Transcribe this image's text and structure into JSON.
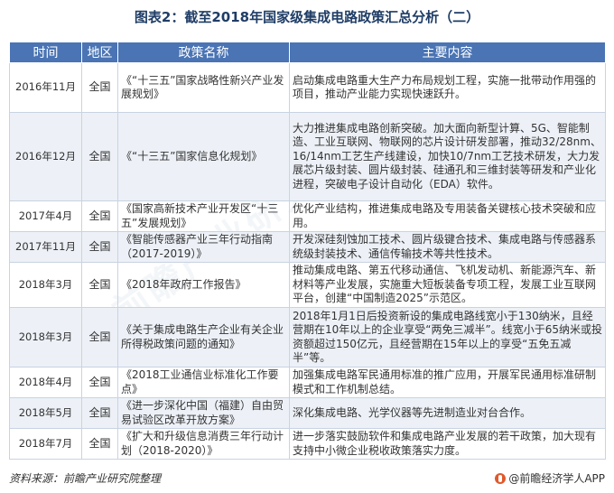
{
  "title": "图表2：截至2018年国家级集成电路政策汇总分析（二）",
  "table": {
    "headers": [
      "时间",
      "地区",
      "政策名称",
      "主要内容"
    ],
    "rows": [
      {
        "time": "2016年11月",
        "region": "全国",
        "name": "《“十三五”国家战略性新兴产业发展规划》",
        "content": "启动集成电路重大生产力布局规划工程，实施一批带动作用强的项目，推动产业能力实现快速跃升。"
      },
      {
        "time": "2016年12月",
        "region": "全国",
        "name": "《“十三五”国家信息化规划》",
        "content": "大力推进集成电路创新突破。加大面向新型计算、5G、智能制造、工业互联网、物联网的芯片设计研发部署，推动32/28nm、16/14nm工艺生产线建设，加快10/7nm工艺技术研发，大力发展芯片级封装、圆片级封装、硅通孔和三维封装等研发和产业化进程，突破电子设计自动化（EDA）软件。"
      },
      {
        "time": "2017年4月",
        "region": "全国",
        "name": "《国家高新技术产业开发区“十三五”发展规划》",
        "content": "优化产业结构，推进集成电路及专用装备关键核心技术突破和应用。"
      },
      {
        "time": "2017年11月",
        "region": "全国",
        "name": "《智能传感器产业三年行动指南（2017-2019）》",
        "content": "开发深硅刻蚀加工技术、圆片级键合技术、集成电路与传感器系统级封装技术、通信传输技术等共性技术。"
      },
      {
        "time": "2018年3月",
        "region": "全国",
        "name": "《2018年政府工作报告》",
        "content": "推动集成电路、第五代移动通信、飞机发动机、新能源汽车、新材料等产业发展，实施重大短板装备专项工程，发展工业互联网平台，创建“中国制造2025”示范区。"
      },
      {
        "time": "2018年3月",
        "region": "全国",
        "name": "《关于集成电路生产企业有关企业所得税政策问题的通知》",
        "content": "2018年1月1日后投资新设的集成电路线宽小于130纳米，且经营期在10年以上的企业享受“两免三减半”。线宽小于65纳米或投资额超过150亿元，且经营期在15年以上的享受“五免五减半”等。"
      },
      {
        "time": "2018年4月",
        "region": "全国",
        "name": "《2018工业通信业标准化工作要点》",
        "content": "加强集成电路军民通用标准的推广应用，开展军民通用标准研制模式和工作机制总结。"
      },
      {
        "time": "2018年5月",
        "region": "全国",
        "name": "《进一步深化中国（福建）自由贸易试验区改革开放方案》",
        "content": "深化集成电路、光学仪器等先进制造业对台合作。"
      },
      {
        "time": "2018年7月",
        "region": "全国",
        "name": "《扩大和升级信息消费三年行动计划（2018-2020）》",
        "content": "进一步落实鼓励软件和集成电路产业发展的若干政策，加大现有支持中小微企业税收政策落实力度。"
      }
    ]
  },
  "footer": {
    "source": "资料来源：前瞻产业研究院整理",
    "brand": "@前瞻经济学人APP"
  },
  "watermark": "前瞻产业研究院",
  "colors": {
    "header_bg": "#4a74b4",
    "title": "#1f3d66",
    "alt_row": "#edf1f7",
    "border": "#c9d3e2"
  }
}
